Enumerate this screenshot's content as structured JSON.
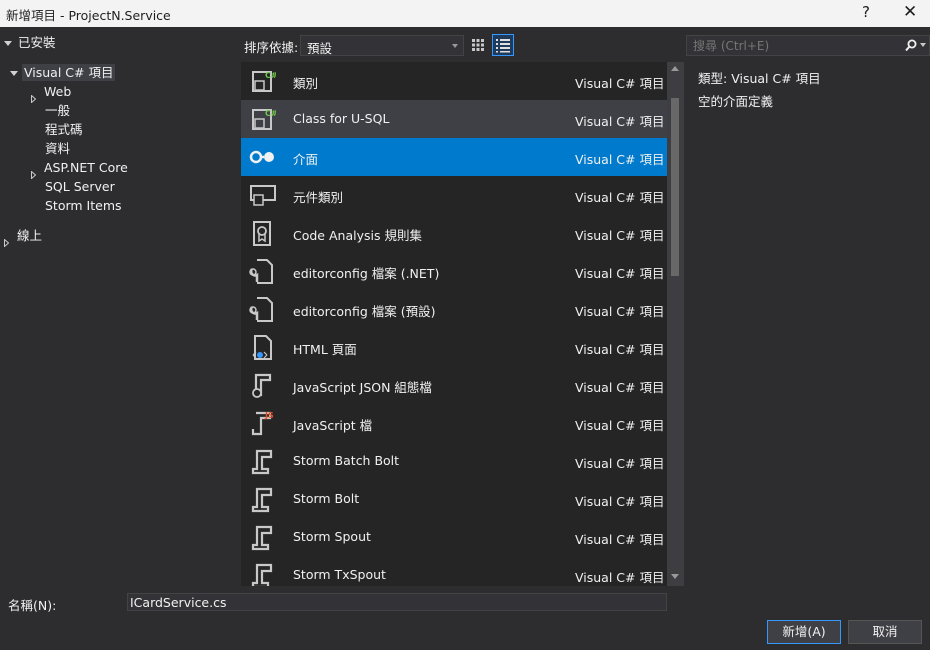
{
  "window": {
    "title": "新增項目 - ProjectN.Service",
    "help": "?",
    "close": "✕"
  },
  "tree": {
    "installed": "已安裝",
    "visual_csharp": "Visual C# 項目",
    "web": "Web",
    "general": "一般",
    "code": "程式碼",
    "data": "資料",
    "aspnet_core": "ASP.NET Core",
    "sql_server": "SQL Server",
    "storm_items": "Storm Items",
    "online": "線上"
  },
  "toolbar": {
    "sort_label": "排序依據:",
    "sort_value": "預設"
  },
  "search": {
    "placeholder": "搜尋 (Ctrl+E)"
  },
  "items": [
    {
      "name": "類別",
      "category": "Visual C# 項目",
      "icon": "class-icon"
    },
    {
      "name": "Class for U-SQL",
      "category": "Visual C# 項目",
      "icon": "class-usql-icon"
    },
    {
      "name": "介面",
      "category": "Visual C# 項目",
      "icon": "interface-icon"
    },
    {
      "name": "元件類別",
      "category": "Visual C# 項目",
      "icon": "component-class-icon"
    },
    {
      "name": "Code Analysis 規則集",
      "category": "Visual C# 項目",
      "icon": "ruleset-icon"
    },
    {
      "name": "editorconfig 檔案 (.NET)",
      "category": "Visual C# 項目",
      "icon": "editorconfig-icon"
    },
    {
      "name": "editorconfig 檔案 (預設)",
      "category": "Visual C# 項目",
      "icon": "editorconfig-icon"
    },
    {
      "name": "HTML 頁面",
      "category": "Visual C# 項目",
      "icon": "html-page-icon"
    },
    {
      "name": "JavaScript JSON 組態檔",
      "category": "Visual C# 項目",
      "icon": "json-config-icon"
    },
    {
      "name": "JavaScript 檔",
      "category": "Visual C# 項目",
      "icon": "javascript-file-icon"
    },
    {
      "name": "Storm Batch Bolt",
      "category": "Visual C# 項目",
      "icon": "storm-icon"
    },
    {
      "name": "Storm Bolt",
      "category": "Visual C# 項目",
      "icon": "storm-icon"
    },
    {
      "name": "Storm Spout",
      "category": "Visual C# 項目",
      "icon": "storm-icon"
    },
    {
      "name": "Storm TxSpout",
      "category": "Visual C# 項目",
      "icon": "storm-icon"
    }
  ],
  "info": {
    "type_label": "類型:",
    "type_value": "Visual C# 項目",
    "description": "空的介面定義"
  },
  "footer": {
    "name_label": "名稱(N):",
    "name_value": "ICardService.cs",
    "add_button": "新增(A)",
    "cancel_button": "取消"
  },
  "colors": {
    "accent": "#007acc",
    "background": "#2d2d30",
    "list_background": "#252526"
  }
}
